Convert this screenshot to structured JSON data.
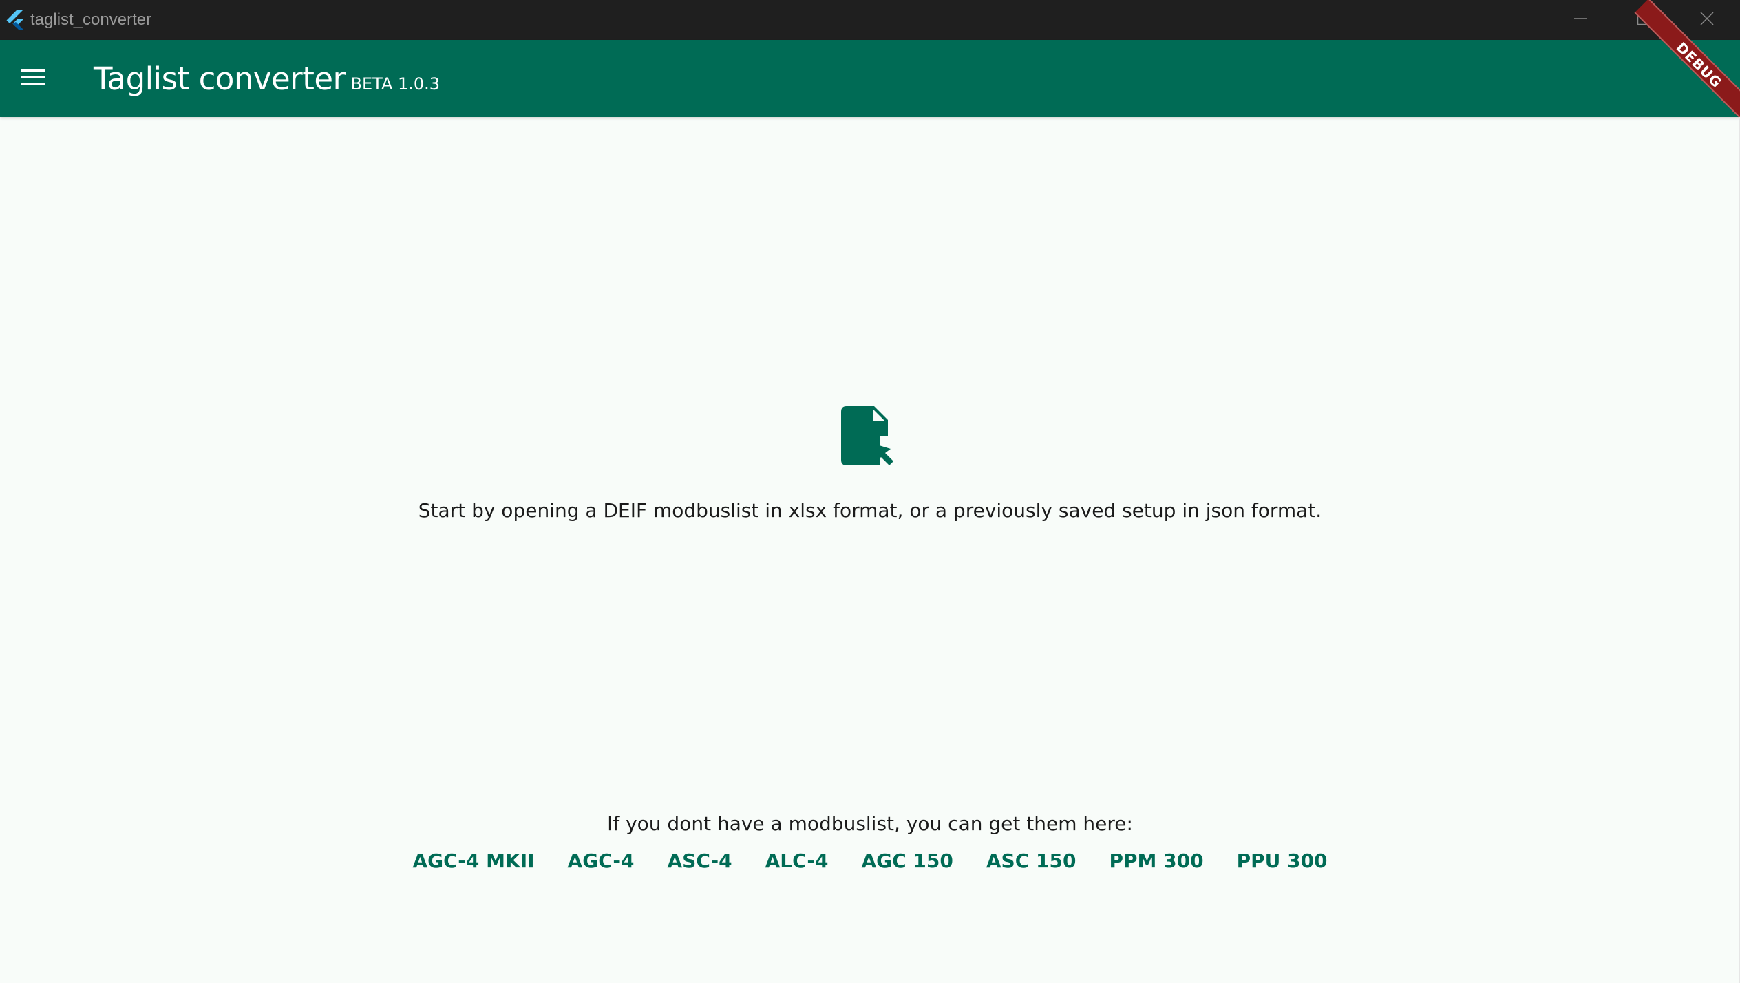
{
  "window": {
    "title": "taglist_converter",
    "controls": [
      "minimize-icon",
      "maximize-icon",
      "close-icon"
    ]
  },
  "appbar": {
    "menu_icon": "menu-icon",
    "title": "Taglist converter",
    "version": "BETA 1.0.3",
    "debug_label": "DEBUG"
  },
  "main": {
    "icon": "file-open-icon",
    "instruction": "Start by opening a DEIF modbuslist in xlsx format, or a previously saved setup in json format.",
    "get_here_text": "If you dont have a modbuslist, you can get them here:",
    "links": [
      {
        "label": "AGC-4 MKII"
      },
      {
        "label": "AGC-4"
      },
      {
        "label": "ASC-4"
      },
      {
        "label": "ALC-4"
      },
      {
        "label": "AGC 150"
      },
      {
        "label": "ASC 150"
      },
      {
        "label": "PPM 300"
      },
      {
        "label": "PPU 300"
      }
    ]
  },
  "colors": {
    "primary": "#006b55",
    "background": "#f8fcf9",
    "titlebar": "#1f1f1f",
    "debug_banner": "#8b1a1a"
  }
}
